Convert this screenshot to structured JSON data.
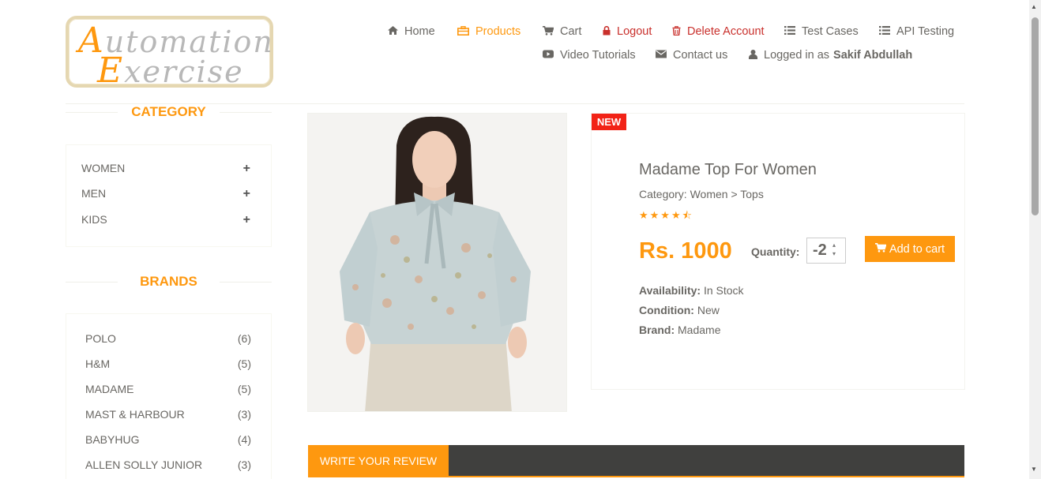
{
  "logo": {
    "line1_cap": "A",
    "line1_rest": "utomation",
    "line2_cap": "E",
    "line2_rest": "xercise"
  },
  "nav": {
    "home": "Home",
    "products": "Products",
    "cart": "Cart",
    "logout": "Logout",
    "delete_account": "Delete Account",
    "test_cases": "Test Cases",
    "api_testing": "API Testing",
    "video_tutorials": "Video Tutorials",
    "contact_us": "Contact us",
    "logged_in_as": "Logged in as",
    "username": "Sakif Abdullah"
  },
  "sidebar": {
    "category_title": "CATEGORY",
    "categories": [
      {
        "label": "WOMEN",
        "toggle": "+"
      },
      {
        "label": "MEN",
        "toggle": "+"
      },
      {
        "label": "KIDS",
        "toggle": "+"
      }
    ],
    "brands_title": "BRANDS",
    "brands": [
      {
        "name": "POLO",
        "count": "(6)"
      },
      {
        "name": "H&M",
        "count": "(5)"
      },
      {
        "name": "MADAME",
        "count": "(5)"
      },
      {
        "name": "MAST & HARBOUR",
        "count": "(3)"
      },
      {
        "name": "BABYHUG",
        "count": "(4)"
      },
      {
        "name": "ALLEN SOLLY JUNIOR",
        "count": "(3)"
      }
    ]
  },
  "product": {
    "badge": "NEW",
    "name": "Madame Top For Women",
    "category": "Category: Women > Tops",
    "rating": 4.5,
    "rating_stars": "★★★★⯪",
    "price": "Rs. 1000",
    "quantity_label": "Quantity:",
    "quantity_value": "-2",
    "add_to_cart": "Add to cart",
    "availability_label": "Availability:",
    "availability_value": "In Stock",
    "condition_label": "Condition:",
    "condition_value": "New",
    "brand_label": "Brand:",
    "brand_value": "Madame"
  },
  "review": {
    "tab_label": "WRITE YOUR REVIEW"
  },
  "colors": {
    "accent": "#fe980f",
    "danger": "#c9302c",
    "badge": "#f22317",
    "dark_bar": "#40403e",
    "text": "#696763"
  },
  "icons": {
    "home": "home-icon",
    "products": "briefcase-icon",
    "cart": "shopping-cart-icon",
    "logout": "lock-icon",
    "delete": "trash-icon",
    "test_cases": "list-icon",
    "api": "list-icon",
    "video": "youtube-play-icon",
    "contact": "envelope-icon",
    "user": "user-icon"
  }
}
